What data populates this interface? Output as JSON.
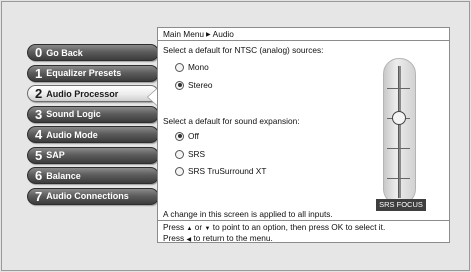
{
  "menu": {
    "items": [
      {
        "num": "0",
        "label": "Go Back"
      },
      {
        "num": "1",
        "label": "Equalizer Presets"
      },
      {
        "num": "2",
        "label": "Audio Processor",
        "selected": true
      },
      {
        "num": "3",
        "label": "Sound Logic"
      },
      {
        "num": "4",
        "label": "Audio Mode"
      },
      {
        "num": "5",
        "label": "SAP"
      },
      {
        "num": "6",
        "label": "Balance"
      },
      {
        "num": "7",
        "label": "Audio Connections"
      }
    ]
  },
  "panel": {
    "breadcrumb": {
      "root": "Main Menu",
      "current": "Audio"
    },
    "ntsc_question": "Select a default for NTSC (analog) sources:",
    "ntsc_options": [
      {
        "label": "Mono",
        "selected": false
      },
      {
        "label": "Stereo",
        "selected": true
      }
    ],
    "expansion_question": "Select a default for sound expansion:",
    "expansion_options": [
      {
        "label": "Off",
        "selected": true
      },
      {
        "label": "SRS",
        "selected": false
      },
      {
        "label": "SRS TruSurround XT",
        "selected": false
      }
    ],
    "slider_label": "SRS FOCUS",
    "note": "A change in this screen is applied to all inputs.",
    "help": {
      "press": "Press",
      "or": "or",
      "line1_rest": "to point to an option, then press OK to select it.",
      "line2_press": "Press",
      "line2_rest": "to return to the menu."
    }
  }
}
